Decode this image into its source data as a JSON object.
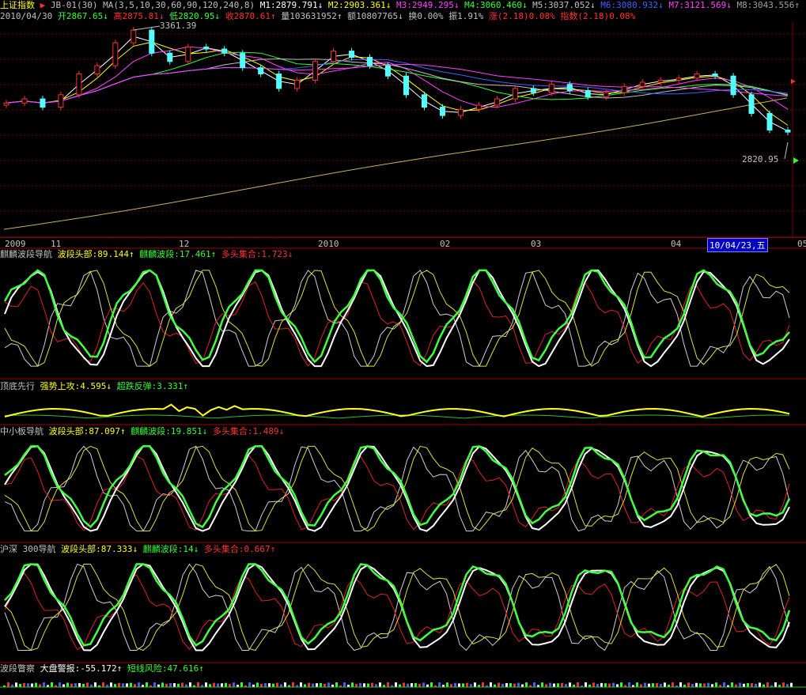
{
  "main": {
    "index_name": "上证指数",
    "formula": "JB-01(30)",
    "ma_params": "MA(3,5,10,30,60,90,120,240,8)",
    "ma_values": [
      {
        "label": "M1:2879.791↓",
        "color": "#ffffff"
      },
      {
        "label": "M2:2903.361↓",
        "color": "#ffff00"
      },
      {
        "label": "M3:2949.295↓",
        "color": "#ff40ff"
      },
      {
        "label": "M4:3060.460↓",
        "color": "#30ff30"
      },
      {
        "label": "M5:3037.052↓",
        "color": "#c0c0c0"
      },
      {
        "label": "M6:3080.932↓",
        "color": "#4060ff"
      },
      {
        "label": "M7:3121.569↓",
        "color": "#ff40ff"
      },
      {
        "label": "M8:3043.556↑",
        "color": "#a0a0a0"
      }
    ],
    "date": "2010/04/30",
    "open": "开2867.65↓",
    "high": "高2875.81↓",
    "low": "低2820.95↓",
    "close": "收2870.61↑",
    "volume": "量103631952↑",
    "amount": "额10807765↓",
    "turnover": "换0.00%",
    "amplitude": "振1.91%",
    "change": "涨(2.18)0.08%",
    "index_change": "指数(2.18)0.08%",
    "max_label": "3361.39",
    "min_label": "2820.95",
    "x_ticks": [
      "2009",
      "11",
      "12",
      "2010",
      "02",
      "03",
      "04",
      "05"
    ],
    "cursor_label": "10/04/23,五"
  },
  "panel1": {
    "title": "麒麟波段导航",
    "values": [
      {
        "label": "波段头部:89.144↑",
        "color": "#ffff00"
      },
      {
        "label": "麒麟波段:17.461↑",
        "color": "#30ff30"
      },
      {
        "label": "多头集合:1.723↓",
        "color": "#ff3030"
      }
    ]
  },
  "panel2": {
    "title": "顶底先行",
    "values": [
      {
        "label": "强势上攻:4.595↓",
        "color": "#ffff00"
      },
      {
        "label": "超跌反弹:3.331↑",
        "color": "#30ff30"
      }
    ]
  },
  "panel3": {
    "title": "中小板导航",
    "values": [
      {
        "label": "波段头部:87.097↑",
        "color": "#ffff00"
      },
      {
        "label": "麒麟波段:19.851↓",
        "color": "#30ff30"
      },
      {
        "label": "多头集合:1.489↓",
        "color": "#ff3030"
      }
    ]
  },
  "panel4": {
    "title": "沪深 300导航",
    "values": [
      {
        "label": "波段头部:87.333↓",
        "color": "#ffff00"
      },
      {
        "label": "麒麟波段:14↓",
        "color": "#30ff30"
      },
      {
        "label": "多头集合:0.667↑",
        "color": "#ff3030"
      }
    ]
  },
  "panel5": {
    "title": "波段瞥察",
    "values": [
      {
        "label": "大盘警报:-55.172↑",
        "color": "#ffffff"
      },
      {
        "label": "短线风险:47.616↑",
        "color": "#30ff30"
      }
    ]
  },
  "chart_data": {
    "type": "candlestick",
    "title": "上证指数",
    "ylim": [
      2820.95,
      3361.39
    ],
    "period_start": "2009-10",
    "period_end": "2010-04-30",
    "close_series": [
      3010,
      3030,
      2990,
      3050,
      3150,
      3190,
      3300,
      3361,
      3250,
      3210,
      3280,
      3270,
      3250,
      3180,
      3150,
      3080,
      3120,
      3210,
      3260,
      3230,
      3190,
      3140,
      3050,
      2990,
      2950,
      2980,
      3000,
      3030,
      3080,
      3060,
      3100,
      3070,
      3040,
      3060,
      3090,
      3110,
      3120,
      3130,
      3150,
      3140,
      3050,
      2960,
      2880,
      2870
    ]
  }
}
